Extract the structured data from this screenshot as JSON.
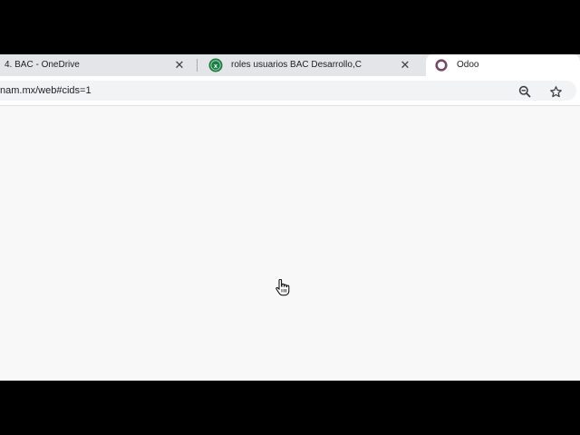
{
  "tabs": [
    {
      "title": "4. BAC - OneDrive",
      "close": "✕"
    },
    {
      "title": "roles usuarios BAC Desarrollo,C",
      "close": "✕"
    },
    {
      "title": "Odoo"
    }
  ],
  "address_bar": {
    "url": "nam.mx/web#cids=1"
  },
  "icons": {
    "tab2_favicon": "excel-icon",
    "tab3_favicon": "odoo-icon",
    "zoom": "zoom-out-icon",
    "bookmark": "star-icon",
    "cursor": "hand-pointer-icon"
  },
  "colors": {
    "excel_green": "#1f7a45",
    "odoo_purple": "#714b67",
    "page_background": "#f8f8f8"
  }
}
